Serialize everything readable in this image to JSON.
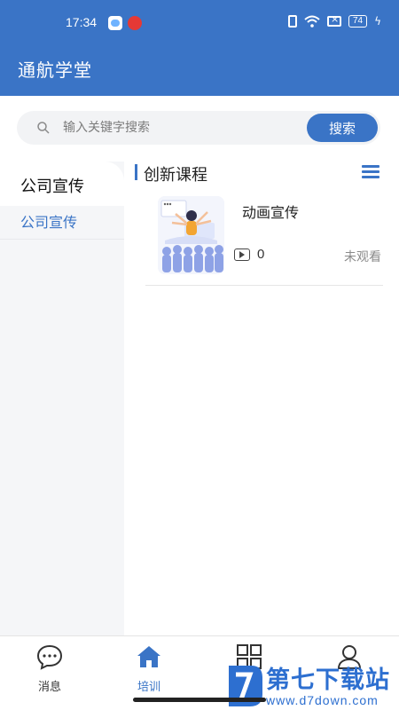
{
  "status_bar": {
    "time": "17:34",
    "battery": "74"
  },
  "header": {
    "title": "通航学堂"
  },
  "search": {
    "placeholder": "输入关键字搜索",
    "button_label": "搜索"
  },
  "sidebar": {
    "category": "公司宣传",
    "items": [
      {
        "label": "公司宣传"
      }
    ]
  },
  "main": {
    "section_title": "创新课程",
    "courses": [
      {
        "title": "动画宣传",
        "play_count": "0",
        "status": "未观看"
      }
    ]
  },
  "tabbar": {
    "tabs": [
      {
        "label": "消息",
        "icon": "message-icon"
      },
      {
        "label": "培训",
        "icon": "home-icon",
        "active": true
      },
      {
        "label": "",
        "icon": "grid-icon"
      },
      {
        "label": "",
        "icon": "person-icon"
      }
    ]
  },
  "watermark": {
    "brand": "第七下载站",
    "url": "www.d7down.com"
  },
  "colors": {
    "primary": "#3a74c6",
    "sidebar_bg": "#f5f6f8",
    "search_bg": "#f2f3f5"
  }
}
